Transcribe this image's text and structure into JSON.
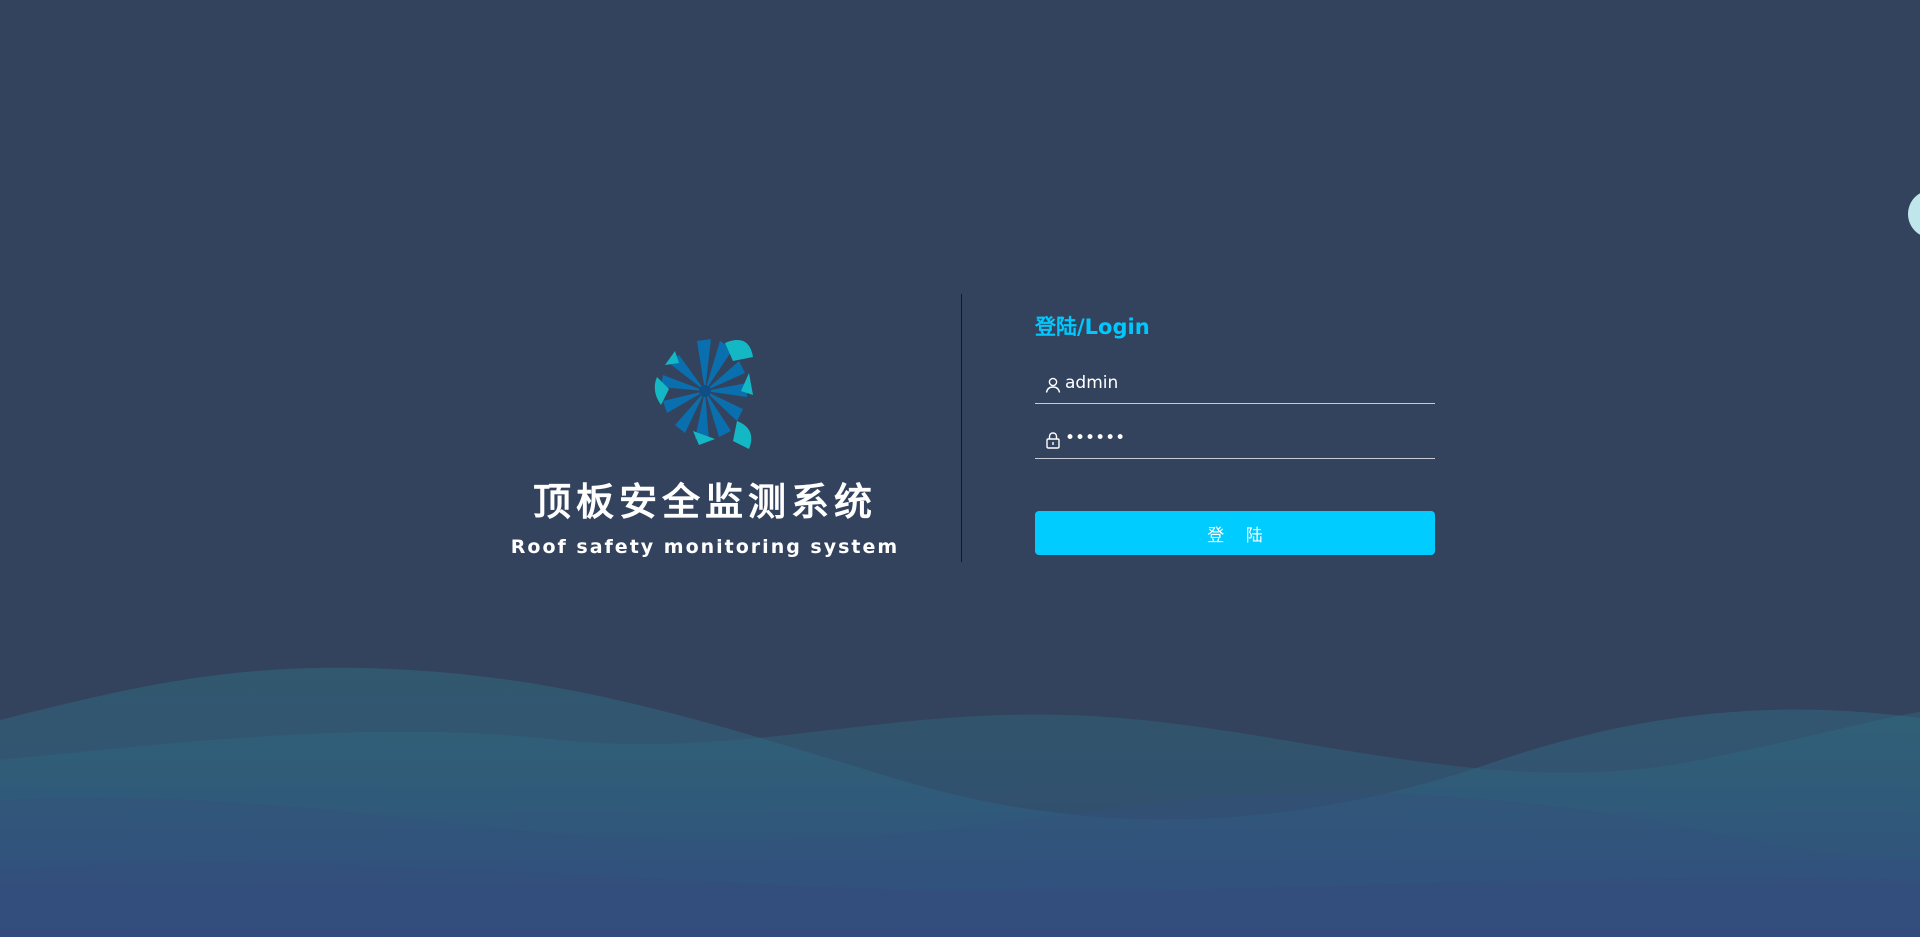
{
  "brand": {
    "title": "顶板安全监测系统",
    "subtitle": "Roof safety monitoring system",
    "logo_icon": "triangle-fan-logo-icon"
  },
  "login": {
    "title": "登陆/Login",
    "username": {
      "value": "admin",
      "icon": "user-icon"
    },
    "password": {
      "value": "123456",
      "icon": "lock-icon"
    },
    "submit_label": "登 陆"
  },
  "colors": {
    "background": "#33435e",
    "accent": "#00ccff",
    "logo_dark_blue": "#0a6fae",
    "logo_teal": "#14b8c4",
    "wave": "#2f6a80"
  }
}
